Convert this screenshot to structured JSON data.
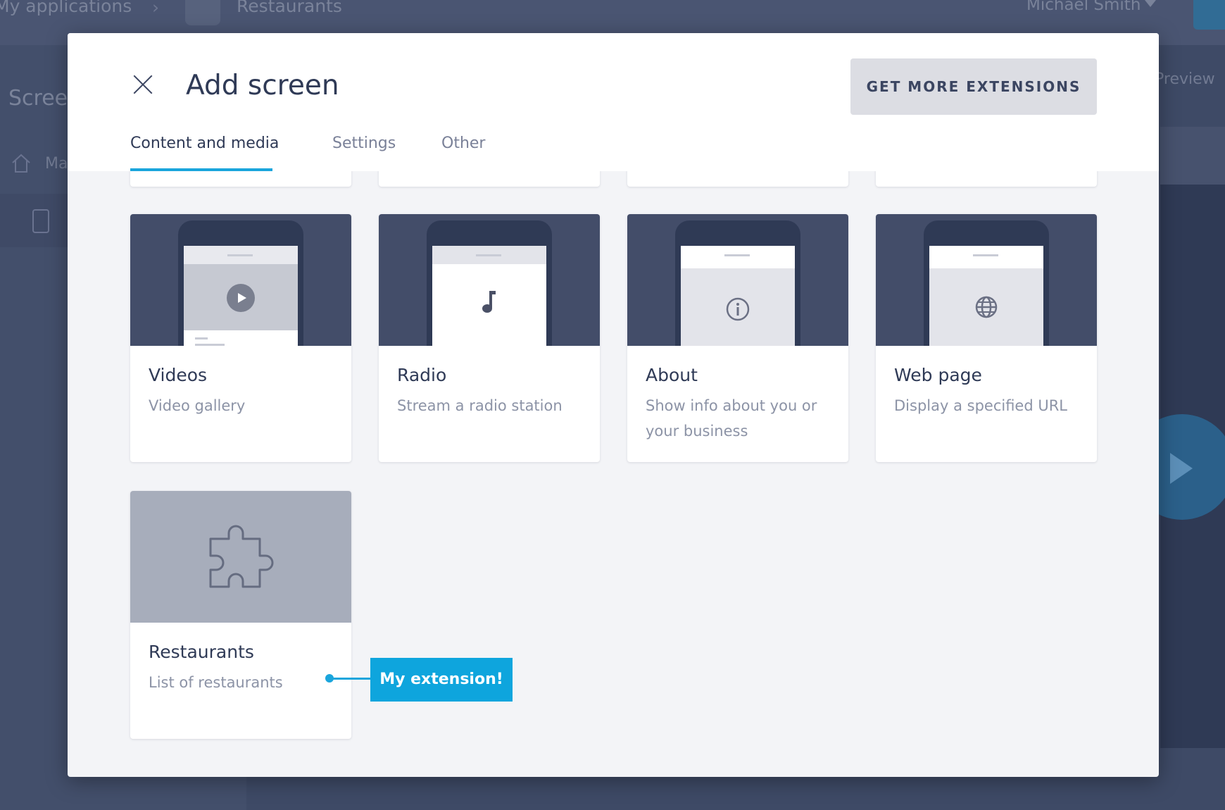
{
  "background": {
    "breadcrumb": "My applications",
    "app_name": "Restaurants",
    "user_name": "Michael Smith",
    "section_title": "Screens",
    "sidebar_item": "Ma",
    "preview_label": "Preview"
  },
  "modal": {
    "title": "Add screen",
    "get_more_label": "GET MORE EXTENSIONS",
    "tabs": [
      {
        "label": "Content and media",
        "active": true
      },
      {
        "label": "Settings",
        "active": false
      },
      {
        "label": "Other",
        "active": false
      }
    ],
    "cards": [
      {
        "title": "Videos",
        "description": "Video gallery",
        "icon": "play-icon"
      },
      {
        "title": "Radio",
        "description": "Stream a radio station",
        "icon": "music-note-icon"
      },
      {
        "title": "About",
        "description": "Show info about you or your business",
        "icon": "info-icon"
      },
      {
        "title": "Web page",
        "description": "Display a specified URL",
        "icon": "globe-icon"
      },
      {
        "title": "Restaurants",
        "description": "List of restaurants",
        "icon": "puzzle-piece-icon"
      }
    ],
    "callout": "My extension!"
  },
  "colors": {
    "accent": "#1aa5dc",
    "callout": "#0ea5dd",
    "title_text": "#2f3a56",
    "muted_text": "#8c93a6"
  }
}
